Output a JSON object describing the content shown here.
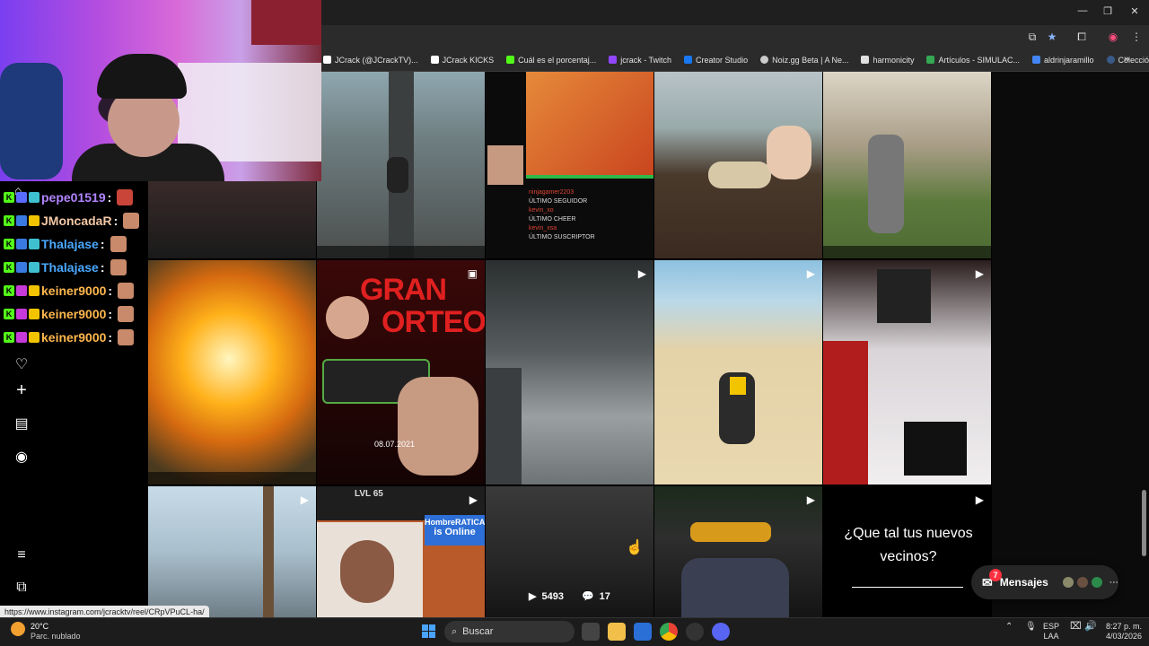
{
  "browser": {
    "bookmarks": [
      {
        "label": "JCrack (@JCrackTV)...",
        "color": "#ffffff"
      },
      {
        "label": "JCrack KICKS",
        "color": "#ffffff"
      },
      {
        "label": "Cuál es el porcentaj...",
        "color": "#53fc18"
      },
      {
        "label": "jcrack - Twitch",
        "color": "#9146ff"
      },
      {
        "label": "Creator Studio",
        "color": "#1877f2"
      },
      {
        "label": "Noiz.gg Beta | A Ne...",
        "color": "#cccccc"
      },
      {
        "label": "harmonicity",
        "color": "#e0e0e0"
      },
      {
        "label": "Artículos - SIMULAC...",
        "color": "#34a853"
      },
      {
        "label": "aldrinjaramillo",
        "color": "#4285f4"
      },
      {
        "label": "Colección de M_blei...",
        "color": "#3a5a8a"
      }
    ],
    "more_bookmarks": "»"
  },
  "chat": [
    {
      "user": "pepe01519",
      "color": "#b184ff"
    },
    {
      "user": "JMoncadaR",
      "color": "#f3c8a6"
    },
    {
      "user": "Thalajase",
      "color": "#4aa8ff"
    },
    {
      "user": "Thalajase",
      "color": "#4aa8ff"
    },
    {
      "user": "keiner9000",
      "color": "#ffb84d"
    },
    {
      "user": "keiner9000",
      "color": "#ffb84d"
    },
    {
      "user": "keiner9000",
      "color": "#ffb84d"
    }
  ],
  "chat_separator": ":",
  "tiles": {
    "gran_sorteo_title_1": "GRAN",
    "gran_sorteo_title_2": "ORTEO",
    "gran_sorteo_date": "08.07.2021",
    "level_text": "LVL 65",
    "online_user": "HombreRATICA",
    "online_status": "is Online",
    "overlay_list": [
      "ninjagamer2203",
      "ÚLTIMO SEGUIDOR",
      "kevin_xo",
      "ÚLTIMO CHEER",
      "kevin_xsa",
      "ÚLTIMO SUSCRIPTOR"
    ],
    "views": "5493",
    "comments": "17",
    "vecinos_text": "¿Que tal tus nuevos vecinos?"
  },
  "messages": {
    "label": "Mensajes",
    "badge": "7"
  },
  "status_url": "https://www.instagram.com/jcracktv/reel/CRpVPuCL-ha/",
  "taskbar": {
    "weather_temp": "20°C",
    "weather_desc": "Parc. nublado",
    "search_placeholder": "Buscar",
    "lang_1": "ESP",
    "lang_2": "LAA",
    "time": "8:27 p. m.",
    "date": "4/03/2026"
  }
}
